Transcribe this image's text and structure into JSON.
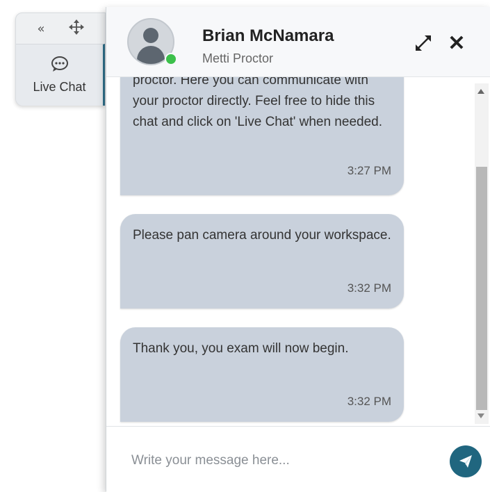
{
  "mini_panel": {
    "collapse_icon": "double-chevron-left-icon",
    "move_icon": "move-arrows-icon",
    "chat_icon": "chat-bubble-icon",
    "chat_label": "Live Chat"
  },
  "header": {
    "name": "Brian McNamara",
    "role": "Metti Proctor",
    "status": "online",
    "status_color": "#3cc04b"
  },
  "messages": [
    {
      "text": "proctor. Here you can communicate with your proctor directly. Feel free to hide this chat and click on 'Live Chat' when needed.",
      "time": "3:27 PM"
    },
    {
      "text": "Please pan camera around your workspace.",
      "time": "3:32 PM"
    },
    {
      "text": "Thank you, you exam will now begin.",
      "time": "3:32 PM"
    }
  ],
  "input": {
    "placeholder": "Write your message here...",
    "value": ""
  },
  "colors": {
    "bubble": "#c9d1dc",
    "accent": "#20667f"
  }
}
